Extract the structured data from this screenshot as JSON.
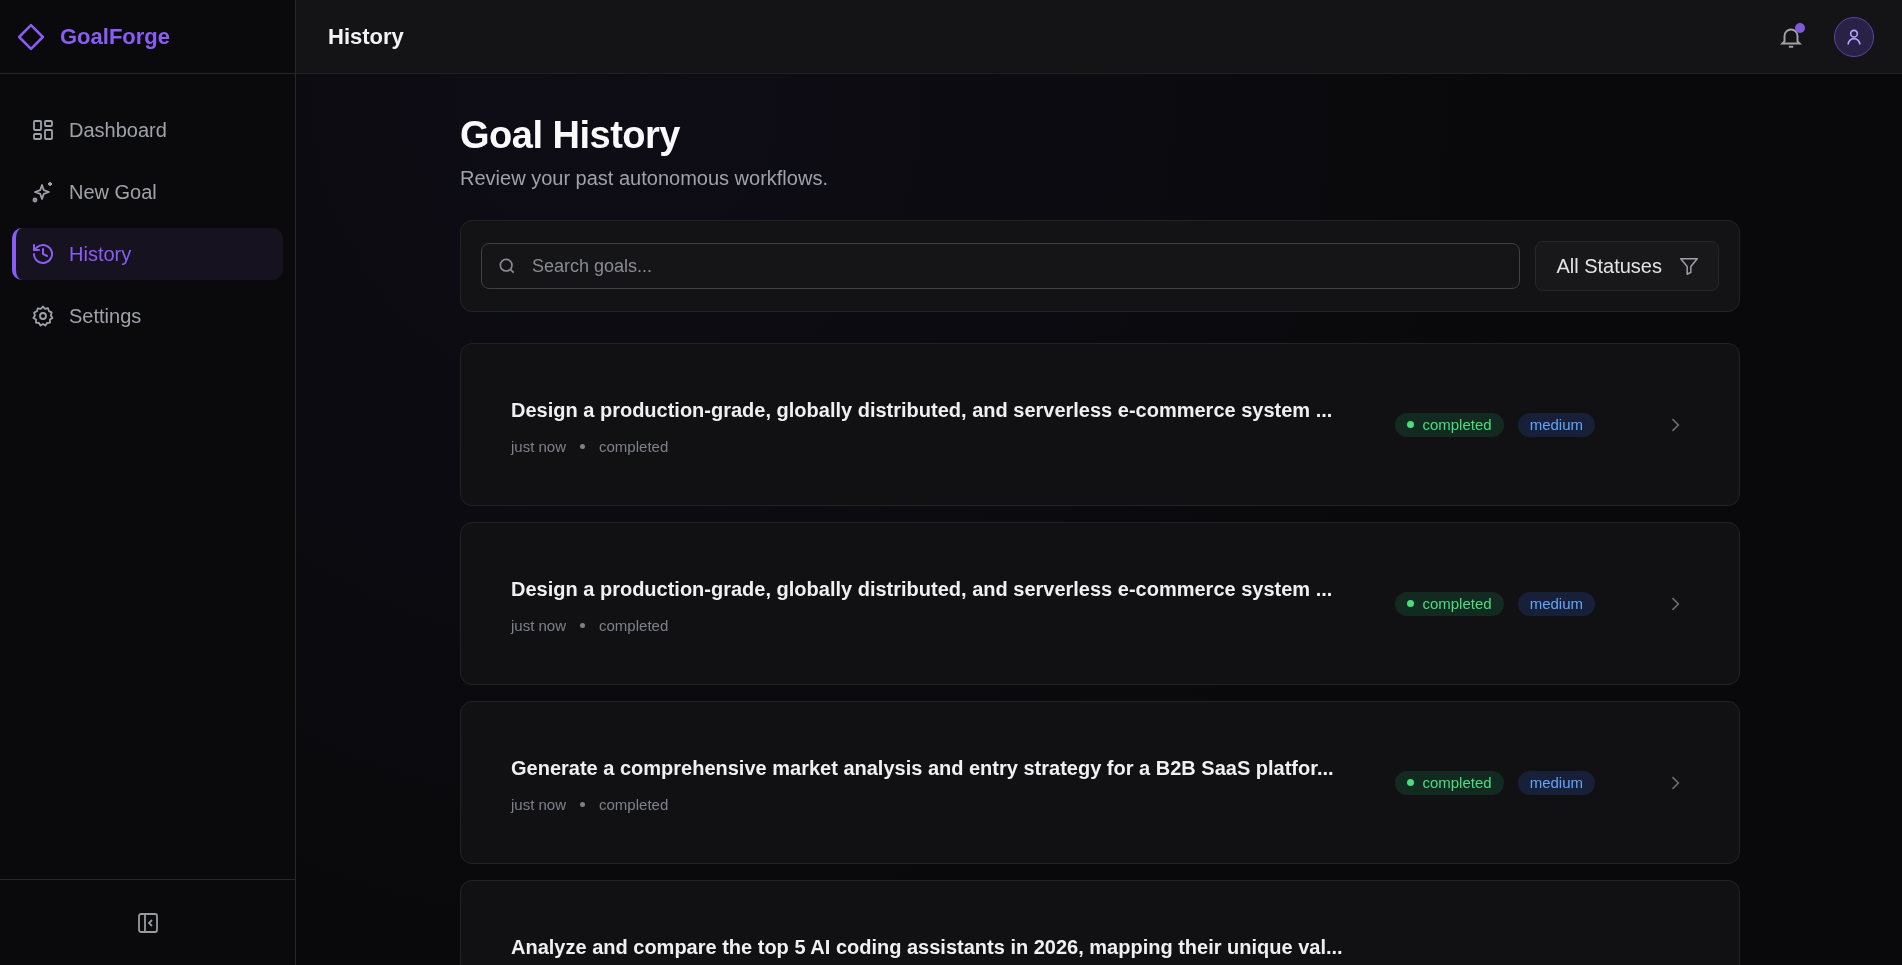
{
  "brand": {
    "name": "GoalForge"
  },
  "sidebar": {
    "items": [
      {
        "label": "Dashboard",
        "selected": false
      },
      {
        "label": "New Goal",
        "selected": false
      },
      {
        "label": "History",
        "selected": true
      },
      {
        "label": "Settings",
        "selected": false
      }
    ]
  },
  "header": {
    "title": "History",
    "notification_unread": true
  },
  "page": {
    "title": "Goal History",
    "subtitle": "Review your past autonomous workflows."
  },
  "search": {
    "placeholder": "Search goals..."
  },
  "status_filter": {
    "label": "All Statuses"
  },
  "goals": [
    {
      "title": "Design a production-grade, globally distributed, and serverless e-commerce system ...",
      "time": "just now",
      "meta_status": "completed",
      "status": "completed",
      "priority": "medium"
    },
    {
      "title": "Design a production-grade, globally distributed, and serverless e-commerce system ...",
      "time": "just now",
      "meta_status": "completed",
      "status": "completed",
      "priority": "medium"
    },
    {
      "title": "Generate a comprehensive market analysis and entry strategy for a B2B SaaS platfor...",
      "time": "just now",
      "meta_status": "completed",
      "status": "completed",
      "priority": "medium"
    },
    {
      "title": "Analyze and compare the top 5 AI coding assistants in 2026, mapping their unique val..."
    }
  ]
}
